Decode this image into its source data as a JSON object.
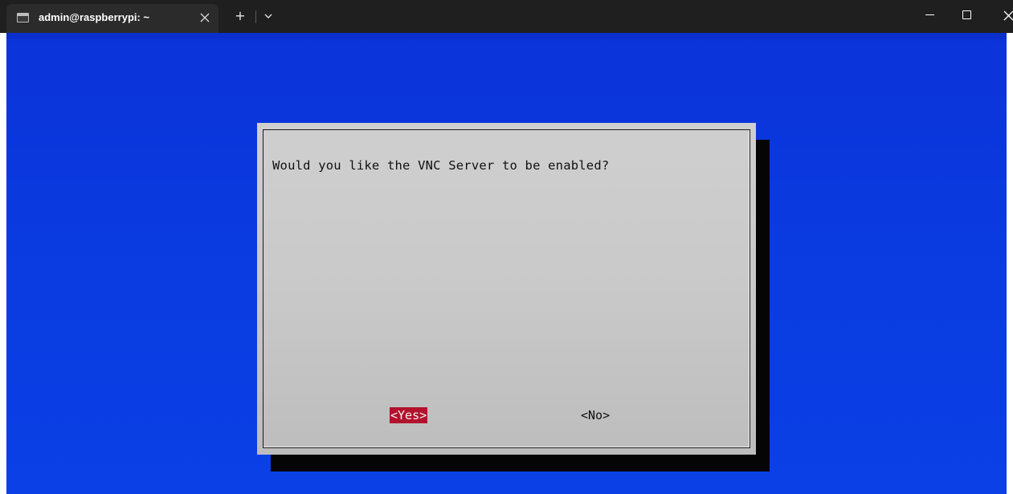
{
  "window": {
    "tab_title": "admin@raspberrypi: ~",
    "tab_close_icon": "close-icon",
    "new_tab_label": "+",
    "tab_dropdown_icon": "chevron-down-icon",
    "minimize_icon": "minimize-icon",
    "maximize_icon": "maximize-icon",
    "close_icon": "close-icon"
  },
  "dialog": {
    "question": "Would you like the VNC Server to be enabled?",
    "yes_label": "<Yes>",
    "no_label": "<No>",
    "selected": "yes"
  },
  "colors": {
    "titlebar": "#1f1f1f",
    "tab": "#2b2b2b",
    "terminal_bg": "#0a3be0",
    "dialog_bg": "#c9c9c9",
    "dialog_shadow": "#050505",
    "selected_button_bg": "#b3122c"
  }
}
